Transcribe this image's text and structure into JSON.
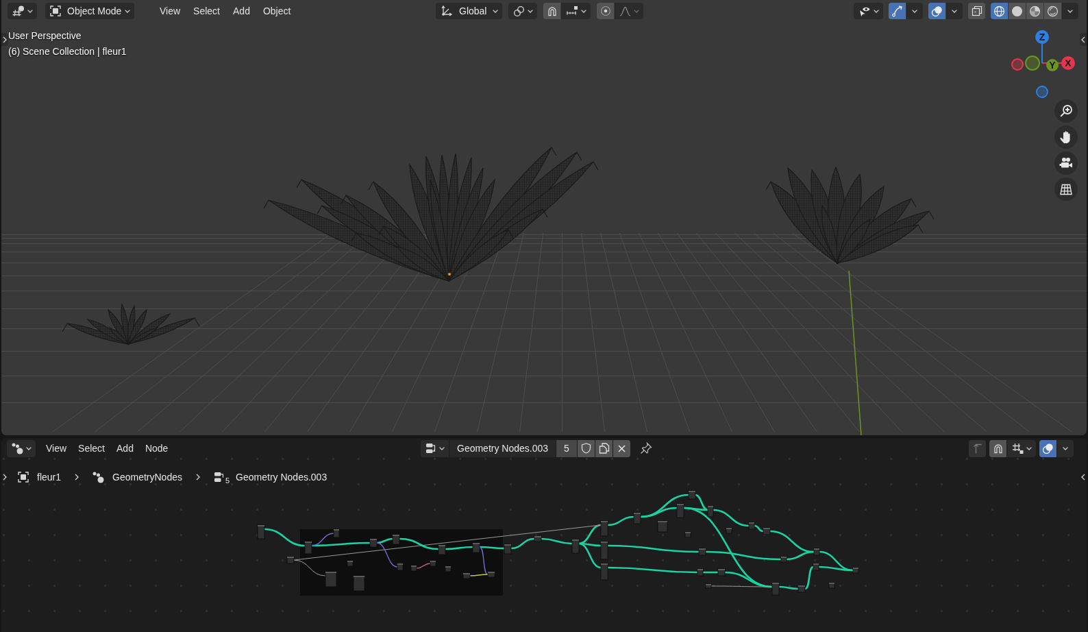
{
  "viewport": {
    "header": {
      "mode": "Object Mode",
      "menus": [
        "View",
        "Select",
        "Add",
        "Object"
      ],
      "orientation": "Global",
      "snap": {
        "on": false
      },
      "proportional_editing": {
        "on": false
      },
      "gizmos": {
        "on": true
      },
      "overlays": {
        "on": true
      },
      "xray": {
        "on": false
      },
      "shading": [
        {
          "kind": "wireframe",
          "selected": true
        },
        {
          "kind": "solid",
          "selected": false
        },
        {
          "kind": "material",
          "selected": false
        },
        {
          "kind": "rendered",
          "selected": false
        }
      ]
    },
    "overlay_text": {
      "view": "User Perspective",
      "collection": "(6) Scene Collection | fleur1"
    },
    "navigation_gizmo": {
      "axes": [
        {
          "label": "Z",
          "color": "#2e7fe0"
        },
        {
          "label": "Y",
          "color": "#6a961f"
        },
        {
          "label": "X",
          "color": "#e8344e"
        }
      ]
    }
  },
  "node_editor": {
    "header": {
      "menus": [
        "View",
        "Select",
        "Add",
        "Node"
      ],
      "node_group": {
        "name": "Geometry Nodes.003",
        "users": "5",
        "fake_user": false
      },
      "pinned": false,
      "parent_disabled": true,
      "snap": {
        "on": false
      },
      "overlays": {
        "on": true
      }
    },
    "breadcrumbs": [
      {
        "kind": "object",
        "label": "fleur1"
      },
      {
        "kind": "modifier",
        "label": "GeometryNodes"
      },
      {
        "kind": "node_tree",
        "label": "Geometry Nodes.003",
        "count": "5"
      }
    ]
  }
}
